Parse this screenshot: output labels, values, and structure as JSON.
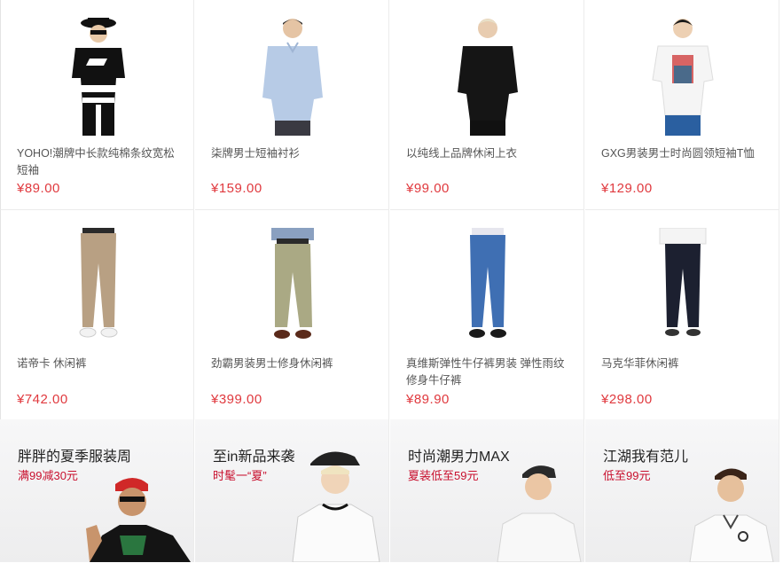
{
  "products_row1": [
    {
      "title": "YOHO!潮牌中长款纯棉条纹宽松短袖",
      "price": "¥89.00"
    },
    {
      "title": "柒牌男士短袖衬衫",
      "price": "¥159.00"
    },
    {
      "title": "以纯线上品牌休闲上衣",
      "price": "¥99.00"
    },
    {
      "title": "GXG男装男士时尚圆领短袖T恤",
      "price": "¥129.00"
    }
  ],
  "products_row2": [
    {
      "title": "诺帝卡 休闲裤",
      "price": "¥742.00"
    },
    {
      "title": "劲霸男装男士修身休闲裤",
      "price": "¥399.00"
    },
    {
      "title": "真维斯弹性牛仔裤男装 弹性雨纹修身牛仔裤",
      "price": "¥89.90"
    },
    {
      "title": "马克华菲休闲裤",
      "price": "¥298.00"
    }
  ],
  "promos": [
    {
      "title": "胖胖的夏季服装周",
      "subtitle": "满99减30元"
    },
    {
      "title": "至in新品来袭",
      "subtitle": "时髦一“夏”"
    },
    {
      "title": "时尚潮男力MAX",
      "subtitle": "夏装低至59元"
    },
    {
      "title": "江湖我有范儿",
      "subtitle": "低至99元"
    }
  ],
  "colors": {
    "price": "#e0393e",
    "promo_subtitle": "#c8102e",
    "grid_line": "#ececec"
  }
}
